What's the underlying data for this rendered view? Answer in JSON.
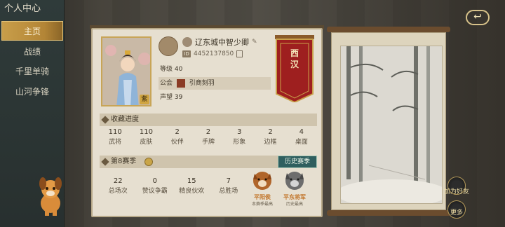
{
  "nav": {
    "title": "个人中心",
    "items": [
      {
        "label": "主页",
        "active": true
      },
      {
        "label": "战绩",
        "active": false
      },
      {
        "label": "千里单骑",
        "active": false
      },
      {
        "label": "山河争锋",
        "active": false
      }
    ]
  },
  "profile": {
    "name": "辽东城中智少卿",
    "id_tag": "ID",
    "id": "4452137850",
    "level_label": "等级",
    "level": "40",
    "guild_label": "公会",
    "guild": "引商刻羽",
    "prestige_label": "声望",
    "prestige": "39",
    "avatar_badge": "紫"
  },
  "banner": {
    "line1": "西",
    "line2": "汉"
  },
  "collection": {
    "title": "收藏进度",
    "items": [
      {
        "value": "110",
        "label": "武将"
      },
      {
        "value": "110",
        "label": "皮肤"
      },
      {
        "value": "2",
        "label": "伙伴"
      },
      {
        "value": "2",
        "label": "手牌"
      },
      {
        "value": "3",
        "label": "形象"
      },
      {
        "value": "2",
        "label": "边框"
      },
      {
        "value": "4",
        "label": "桌面"
      }
    ]
  },
  "season": {
    "title": "第8赛季",
    "history_button": "历史赛季",
    "stats": [
      {
        "value": "22",
        "label": "总场次"
      },
      {
        "value": "0",
        "label": "赞议争霸"
      },
      {
        "value": "15",
        "label": "精良伙欢"
      },
      {
        "value": "7",
        "label": "总胜场"
      }
    ],
    "ranks": [
      {
        "title": "平阳侯",
        "sub": "本赛季最高",
        "color": "#c87a2a"
      },
      {
        "title": "平东将军",
        "sub": "历史最高",
        "color": "#c87a2a"
      }
    ]
  },
  "side": {
    "friend_label": "加为好友",
    "more_label": "更多",
    "back_symbol": "↩"
  }
}
